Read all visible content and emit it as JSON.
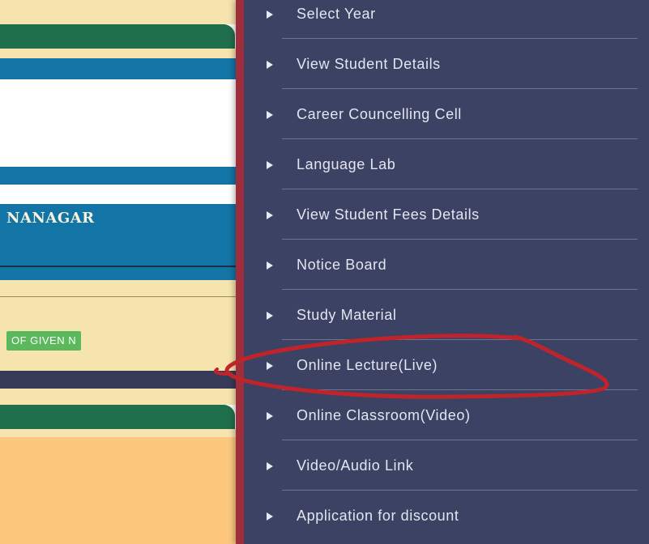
{
  "background_page": {
    "title_fragment": "NANAGAR",
    "badge_text": "OF GIVEN N"
  },
  "drawer": {
    "items": [
      {
        "label": "Select Year"
      },
      {
        "label": "View Student Details"
      },
      {
        "label": "Career Councelling Cell"
      },
      {
        "label": "Language Lab"
      },
      {
        "label": "View Student Fees Details"
      },
      {
        "label": "Notice Board"
      },
      {
        "label": "Study Material"
      },
      {
        "label": "Online Lecture(Live)"
      },
      {
        "label": "Online Classroom(Video)"
      },
      {
        "label": "Video/Audio Link"
      },
      {
        "label": "Application for discount"
      }
    ],
    "highlighted_item": "Online Lecture(Live)",
    "arrow_icon": "triangle-right-icon"
  },
  "colors": {
    "drawer_bg": "#3c4263",
    "drawer_border": "#9f2d3c",
    "annotation_red": "#c0242b",
    "teal": "#1375a6",
    "green": "#1f6e4c",
    "cream": "#f6e4ae",
    "badge_green": "#5cb85c"
  }
}
